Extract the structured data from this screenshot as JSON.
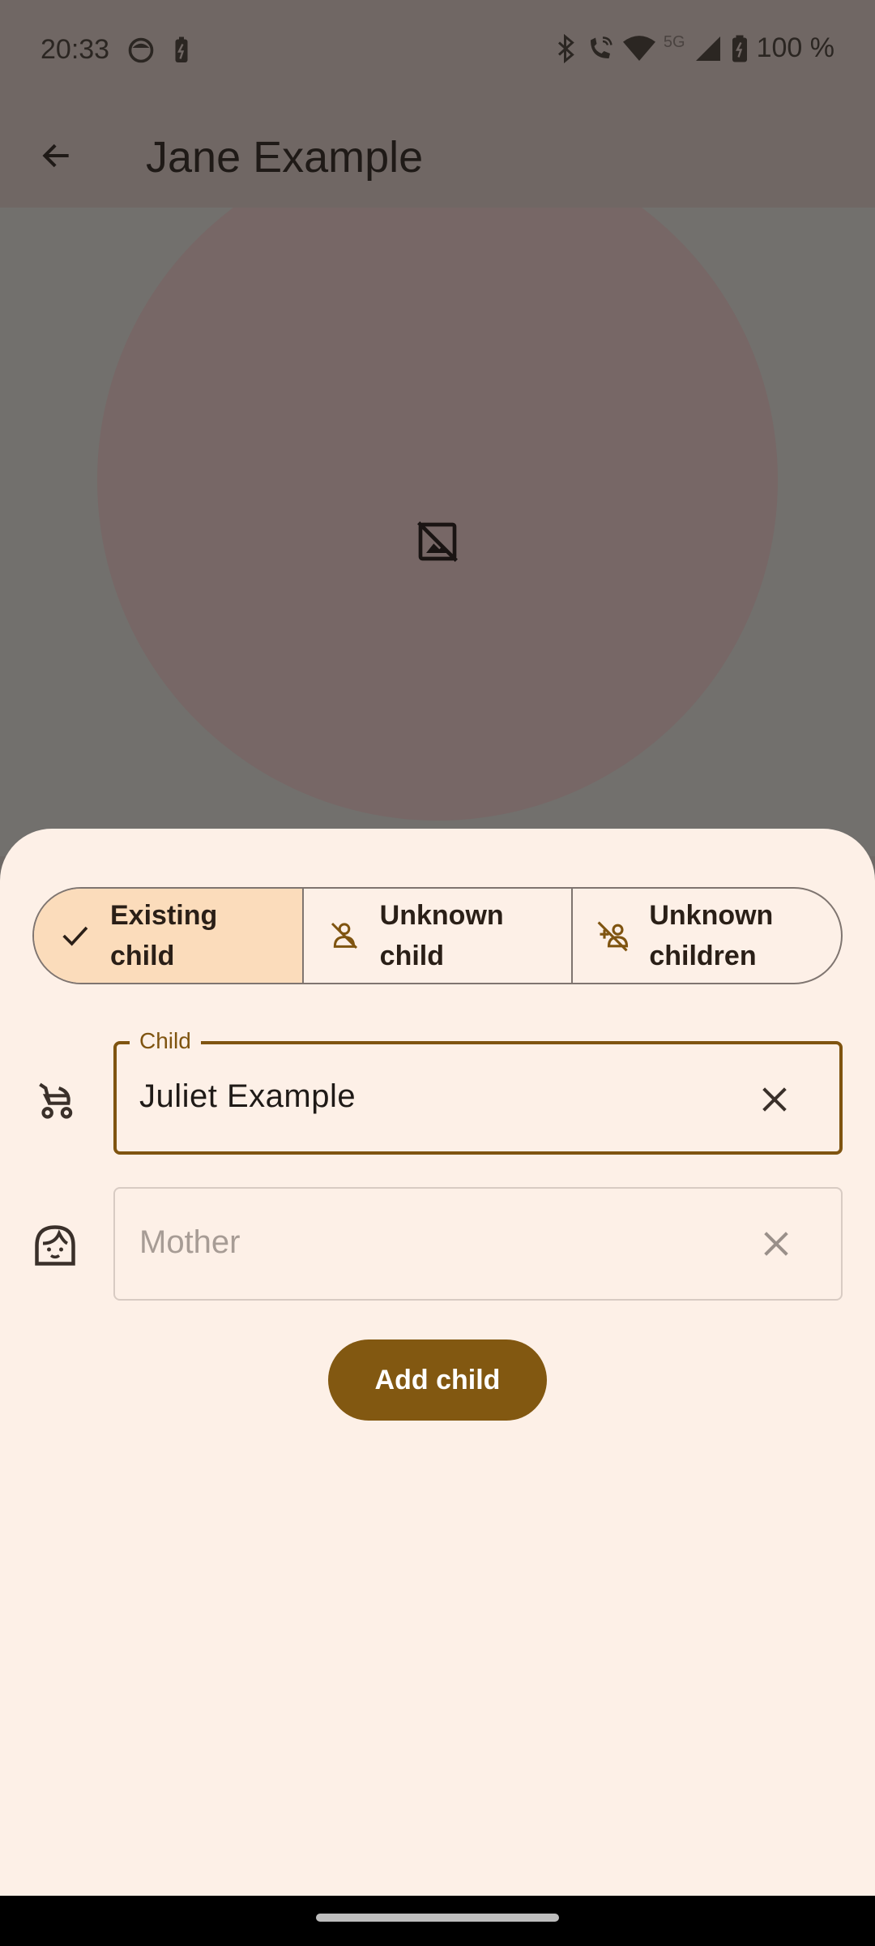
{
  "status_bar": {
    "time": "20:33",
    "battery_percent": "100 %",
    "icons": [
      "face-icon",
      "battery-saver-icon",
      "bluetooth-icon",
      "wifi-calling-icon",
      "wifi-icon",
      "5g-icon",
      "signal-icon",
      "battery-icon"
    ],
    "network_label": "5G"
  },
  "app_bar": {
    "title": "Jane Example",
    "back_icon": "arrow-back-icon"
  },
  "hero": {
    "placeholder_icon": "broken-image-icon"
  },
  "sheet": {
    "segments": [
      {
        "label_line1": "Existing",
        "label_line2": "child",
        "icon": "check-icon",
        "selected": true
      },
      {
        "label_line1": "Unknown",
        "label_line2": "child",
        "icon": "person-off-icon",
        "selected": false
      },
      {
        "label_line1": "Unknown",
        "label_line2": "children",
        "icon": "group-off-icon",
        "selected": false
      }
    ],
    "child_field": {
      "label": "Child",
      "value": "Juliet Example",
      "icon": "stroller-icon"
    },
    "mother_field": {
      "placeholder": "Mother",
      "value": "",
      "icon": "woman-face-icon"
    },
    "add_button_label": "Add child"
  },
  "colors": {
    "accent": "#825811",
    "selected_segment": "#fbdcbb",
    "sheet_background": "#fdf0e7"
  }
}
